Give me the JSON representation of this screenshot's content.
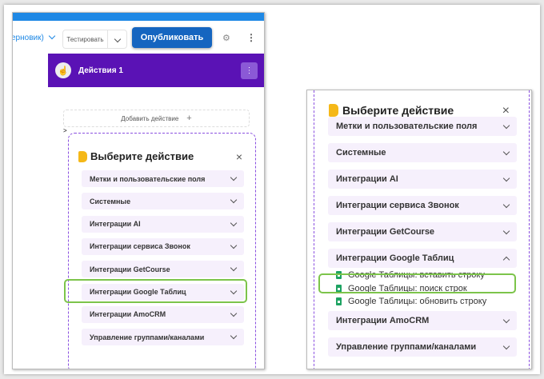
{
  "toolbar": {
    "draft_label": "ерновик)",
    "test_label": "Тестировать",
    "publish_label": "Опубликовать"
  },
  "node": {
    "title": "Действия 1",
    "add_action_label": "Добавить действие",
    "add_icon": "+",
    "connector": ">"
  },
  "chooser": {
    "title": "Выберите действие",
    "close": "×",
    "categories": [
      "Метки и пользовательские поля",
      "Системные",
      "Интеграции AI",
      "Интеграции сервиса Звонок",
      "Интеграции GetCourse",
      "Интеграции Google Таблиц",
      "Интеграции AmoCRM",
      "Управление группами/каналами"
    ],
    "google_actions": [
      "Google Таблицы: вставить строку",
      "Google Таблицы: поиск строк",
      "Google Таблицы: обновить строку"
    ]
  },
  "colors": {
    "header": "#5a12b5",
    "publish": "#1565c0",
    "highlight": "#7cc44a",
    "item_bg": "#f6f0fc"
  }
}
